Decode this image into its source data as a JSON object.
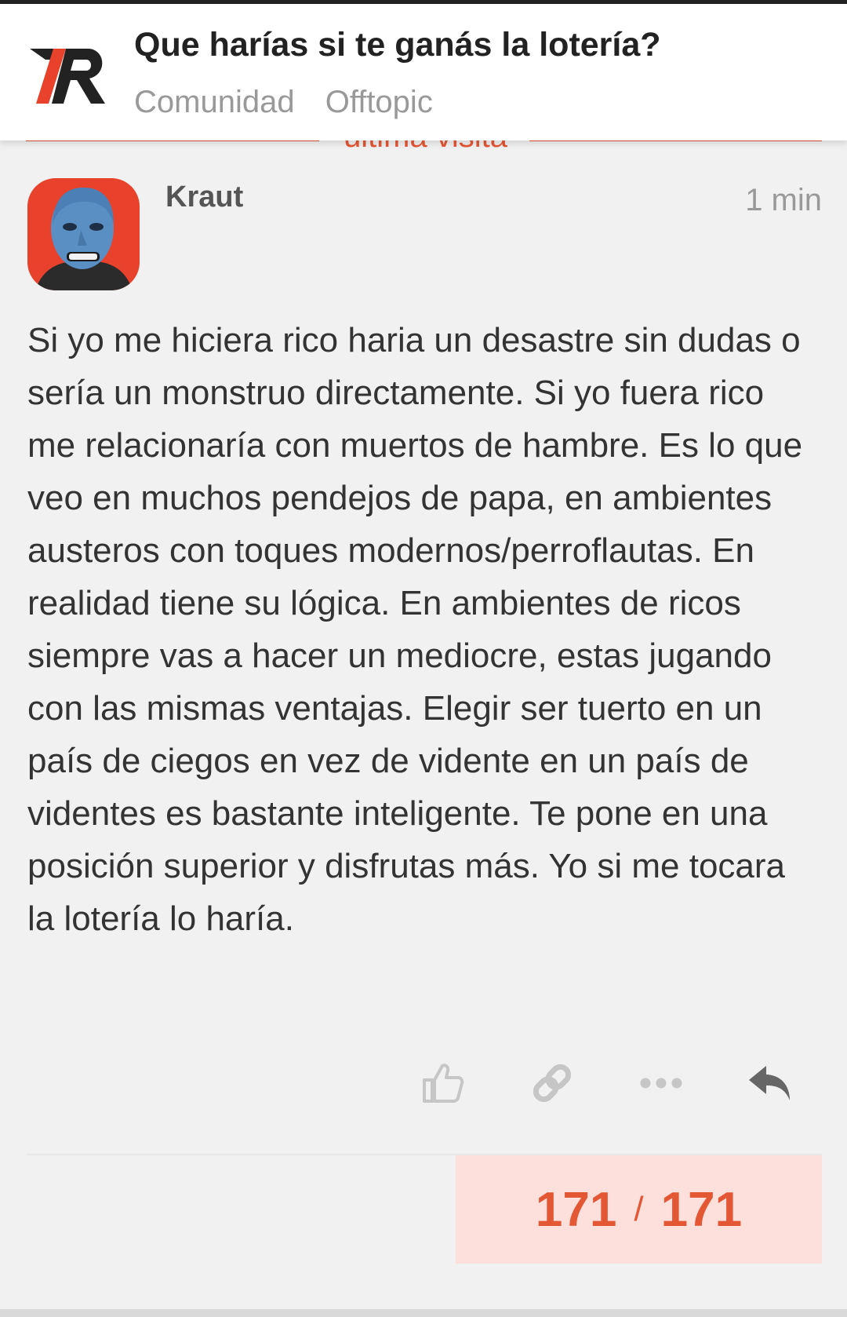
{
  "header": {
    "logo": "7R-logo",
    "title": "Que harías si te ganás la lotería?",
    "breadcrumbs": [
      "Comunidad",
      "Offtopic"
    ]
  },
  "divider": {
    "label": "última visita"
  },
  "post": {
    "username": "Kraut",
    "time": "1 min",
    "avatar": "blue-mask-avatar",
    "body": "Si yo me hiciera rico haria un desastre sin dudas o sería un monstruo directamente. Si yo fuera rico me relacionaría con muertos de hambre. Es lo que veo en muchos pendejos de papa, en ambientes austeros con toques modernos/perroflautas. En realidad tiene su lógica. En ambientes de ricos siempre vas a hacer un mediocre, estas jugando con las mismas ventajas. Elegir ser tuerto en un país de ciegos en vez de vidente en un país de videntes es bastante inteligente. Te pone en una posición superior y disfrutas más. Yo si me tocara la lotería lo haría."
  },
  "actions": [
    "like-icon",
    "link-icon",
    "more-icon",
    "reply-icon"
  ],
  "progress": {
    "current": "171",
    "separator": "/",
    "total": "171"
  },
  "colors": {
    "accent": "#e45735",
    "progress_bg": "#fde0dc",
    "avatar_bg": "#e8412c"
  }
}
